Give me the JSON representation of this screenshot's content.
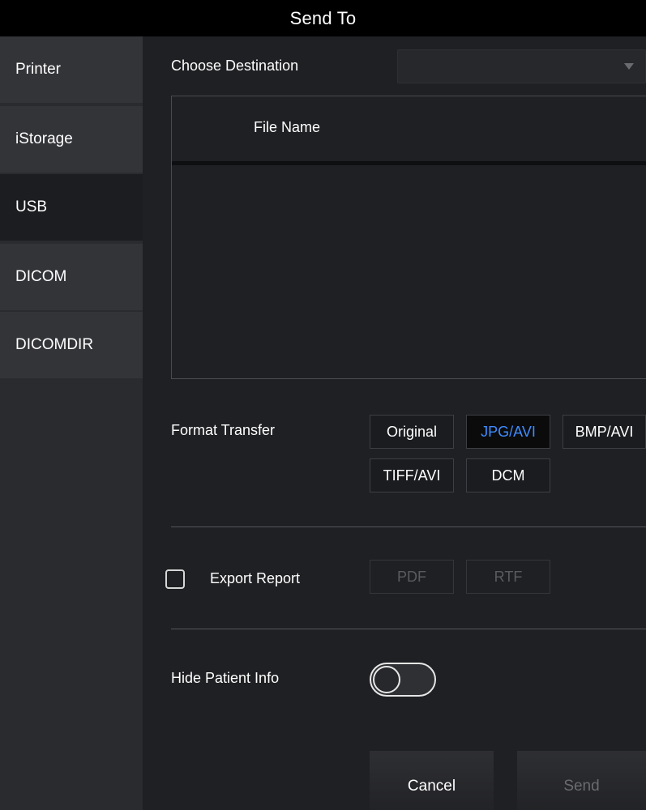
{
  "window": {
    "title": "Send To"
  },
  "sidebar": {
    "items": [
      {
        "label": "Printer"
      },
      {
        "label": "iStorage"
      },
      {
        "label": "USB"
      },
      {
        "label": "DICOM"
      },
      {
        "label": "DICOMDIR"
      }
    ],
    "active": "USB"
  },
  "destination": {
    "label": "Choose Destination",
    "selected_value": "",
    "icon": "chevron-down-icon"
  },
  "file_list": {
    "columns": [
      "File Name"
    ],
    "rows": []
  },
  "format_transfer": {
    "label": "Format Transfer",
    "options": [
      "Original",
      "JPG/AVI",
      "BMP/AVI",
      "TIFF/AVI",
      "DCM"
    ],
    "selected": "JPG/AVI"
  },
  "export_report": {
    "label": "Export Report",
    "checked": false,
    "options": [
      "PDF",
      "RTF"
    ]
  },
  "hide_patient_info": {
    "label": "Hide Patient Info",
    "on": false
  },
  "actions": {
    "cancel_label": "Cancel",
    "send_label": "Send"
  },
  "colors": {
    "accent": "#3f8cff",
    "background": "#1f2023",
    "titlebar": "#000000"
  }
}
